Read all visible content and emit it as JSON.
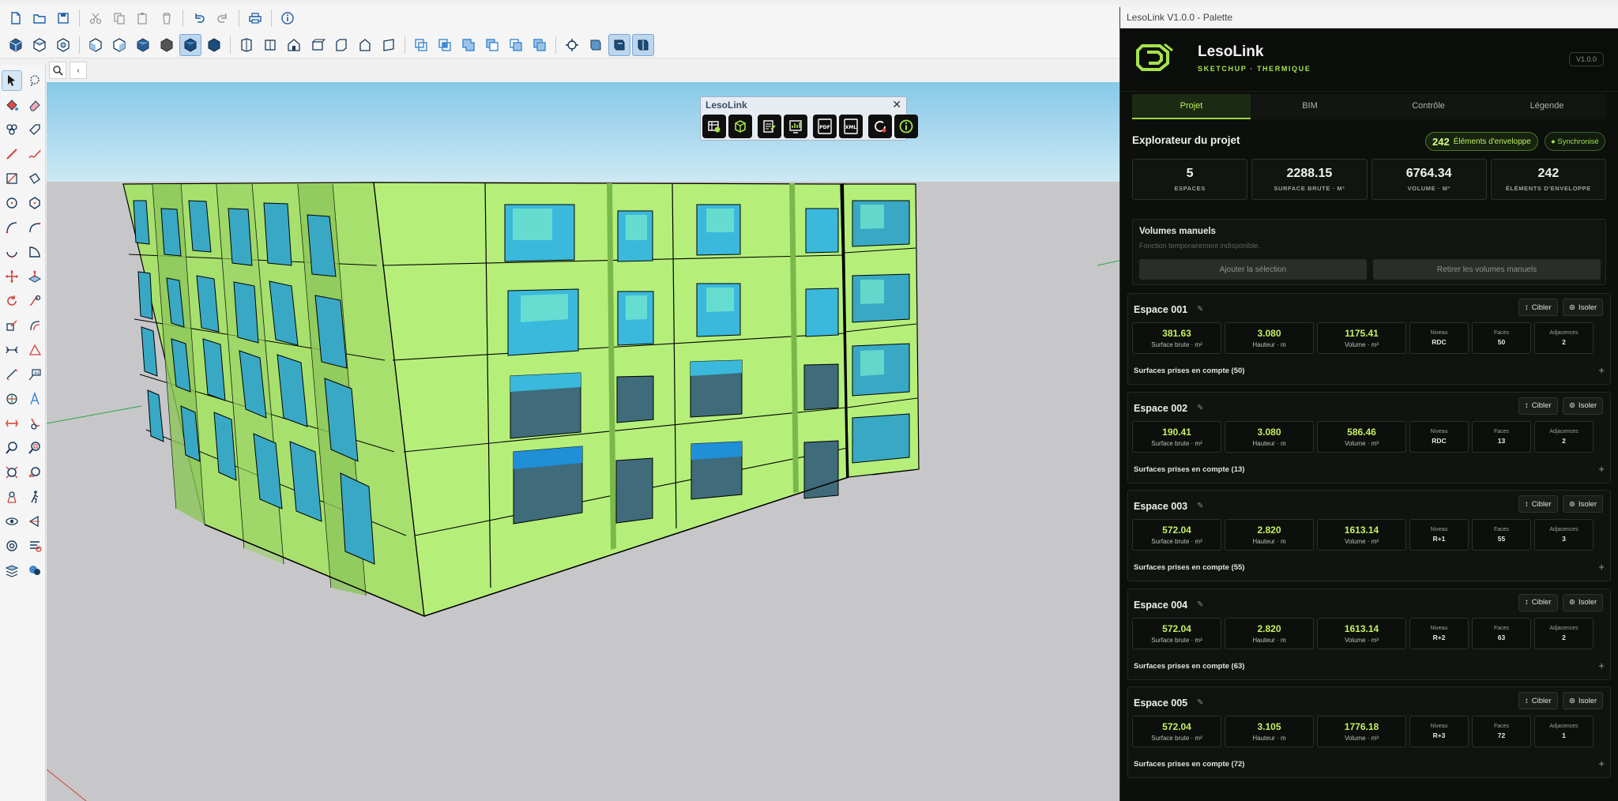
{
  "toolbar": {
    "row1": [
      "new-file-icon",
      "open-folder-icon",
      "save-icon",
      "cut-icon",
      "copy-icon",
      "paste-icon",
      "delete-icon",
      "undo-icon",
      "redo-icon",
      "print-icon",
      "info-icon"
    ],
    "row2": [
      "iso-view-icon",
      "top-view-icon",
      "front-view-icon",
      "right-view-icon",
      "back-view-icon",
      "left-view-icon",
      "xray-icon",
      "wireframe-icon",
      "hidden-line-icon",
      "shaded-icon",
      "textured-icon",
      "monochrome-icon",
      "section-plane-icon",
      "section-display-icon",
      "component-icon",
      "group-icon",
      "outer-shell-icon",
      "intersect-icon",
      "union-icon",
      "subtract-icon",
      "trim-icon",
      "split-icon",
      "position-camera-icon",
      "walk-icon",
      "look-around-icon",
      "zoom-extents-icon"
    ]
  },
  "search": {
    "box2": "‹"
  },
  "floating_toolbar": {
    "title": "LesoLink",
    "close": "✕",
    "buttons": [
      "table-icon",
      "cube-icon",
      "export-icon",
      "chart-icon",
      "pdf-export-icon",
      "xml-export-icon",
      "refresh-icon",
      "info-icon"
    ],
    "pdf_label": "PDF",
    "xml_label": "XML"
  },
  "palette": {
    "window_title": "LesoLink V1.0.0 - Palette",
    "brand_name": "LesoLink",
    "brand_sub": "SKETCHUP · THERMIQUE",
    "version": "V1.0.0",
    "tabs": [
      {
        "label": "Projet",
        "active": true
      },
      {
        "label": "BIM",
        "active": false
      },
      {
        "label": "Contrôle",
        "active": false
      },
      {
        "label": "Légende",
        "active": false
      }
    ],
    "explorer_title": "Explorateur du projet",
    "envelope_count": "242",
    "envelope_label": "Éléments d'enveloppe",
    "sync_label": "● Synchronisé",
    "stats": [
      {
        "value": "5",
        "label": "ESPACES"
      },
      {
        "value": "2288.15",
        "label": "SURFACE BRUTE · M²"
      },
      {
        "value": "6764.34",
        "label": "VOLUME · M³"
      },
      {
        "value": "242",
        "label": "ÉLÉMENTS D'ENVELOPPE"
      }
    ],
    "manual": {
      "title": "Volumes manuels",
      "subtitle": "Fonction temporairement indisponible.",
      "add_label": "Ajouter la sélection",
      "remove_label": "Retirer les volumes manuels"
    },
    "card_labels": {
      "target": "Cibler",
      "isolate": "Isoler",
      "surface": "Surface brute · m²",
      "height": "Hauteur · m",
      "volume": "Volume · m³",
      "level": "Niveau",
      "faces": "Faces",
      "adjacencies": "Adjacences",
      "plus": "+"
    },
    "spaces": [
      {
        "name": "Espace 001",
        "surface": "381.63",
        "height": "3.080",
        "volume": "1175.41",
        "level": "RDC",
        "faces": "50",
        "adj": "2",
        "surfaces_label": "Surfaces prises en compte (50)"
      },
      {
        "name": "Espace 002",
        "surface": "190.41",
        "height": "3.080",
        "volume": "586.46",
        "level": "RDC",
        "faces": "13",
        "adj": "2",
        "surfaces_label": "Surfaces prises en compte (13)"
      },
      {
        "name": "Espace 003",
        "surface": "572.04",
        "height": "2.820",
        "volume": "1613.14",
        "level": "R+1",
        "faces": "55",
        "adj": "3",
        "surfaces_label": "Surfaces prises en compte (55)"
      },
      {
        "name": "Espace 004",
        "surface": "572.04",
        "height": "2.820",
        "volume": "1613.14",
        "level": "R+2",
        "faces": "63",
        "adj": "2",
        "surfaces_label": "Surfaces prises en compte (63)"
      },
      {
        "name": "Espace 005",
        "surface": "572.04",
        "height": "3.105",
        "volume": "1776.18",
        "level": "R+3",
        "faces": "72",
        "adj": "1",
        "surfaces_label": "Surfaces prises en compte (72)"
      }
    ]
  },
  "colors": {
    "accent": "#a6e34a",
    "building": "#b5ef7a",
    "glass": "#3ab9dc",
    "sky": "#9dd6ee",
    "ground": "#c7c7c9"
  }
}
